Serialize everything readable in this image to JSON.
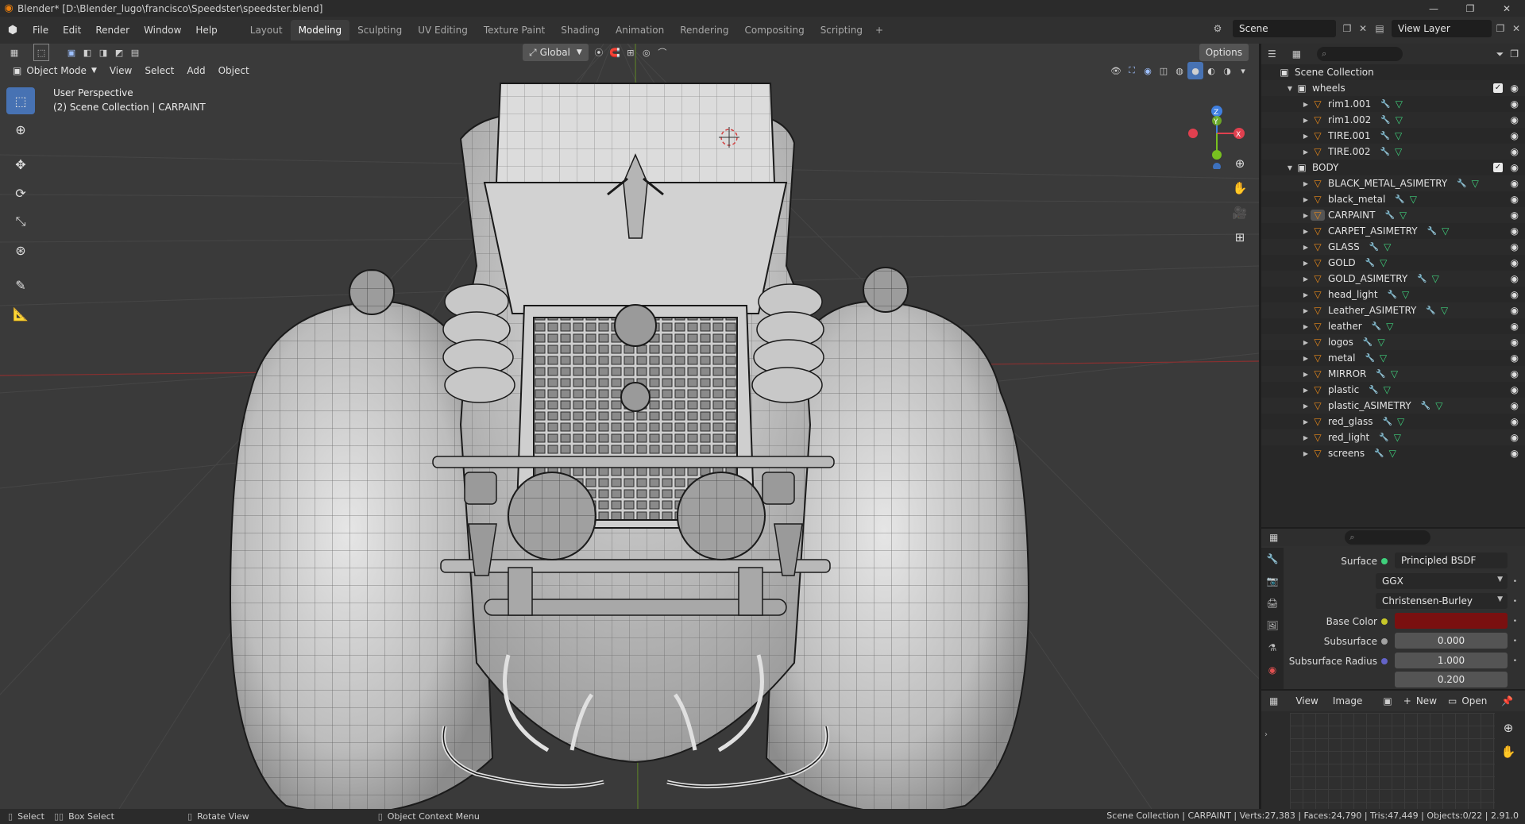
{
  "window": {
    "title": "Blender* [D:\\Blender_lugo\\francisco\\Speedster\\speedster.blend]",
    "controls": [
      "—",
      "❐",
      "✕"
    ]
  },
  "menu": {
    "items": [
      "File",
      "Edit",
      "Render",
      "Window",
      "Help"
    ],
    "workspaces": [
      "Layout",
      "Modeling",
      "Sculpting",
      "UV Editing",
      "Texture Paint",
      "Shading",
      "Animation",
      "Rendering",
      "Compositing",
      "Scripting"
    ],
    "active_workspace": "Modeling",
    "scene": "Scene",
    "view_layer": "View Layer"
  },
  "viewport": {
    "header": {
      "mode": "Object Mode",
      "menus": [
        "View",
        "Select",
        "Add",
        "Object"
      ],
      "orientation": "Global",
      "options": "Options"
    },
    "overlay": {
      "line1": "User Perspective",
      "line2": "(2) Scene Collection | CARPAINT"
    },
    "gizmo_axes": [
      "Z",
      "Y",
      "X"
    ],
    "tools": [
      "select-box-tool",
      "cursor-tool",
      "move-tool",
      "rotate-tool",
      "scale-tool",
      "transform-tool",
      "annotate-tool",
      "measure-tool"
    ]
  },
  "outliner": {
    "root": "Scene Collection",
    "collections": [
      {
        "name": "wheels",
        "items": [
          "rim1.001",
          "rim1.002",
          "TIRE.001",
          "TIRE.002"
        ]
      },
      {
        "name": "BODY",
        "items": [
          "BLACK_METAL_ASIMETRY",
          "black_metal",
          "CARPAINT",
          "CARPET_ASIMETRY",
          "GLASS",
          "GOLD",
          "GOLD_ASIMETRY",
          "head_light",
          "Leather_ASIMETRY",
          "leather",
          "logos",
          "metal",
          "MIRROR",
          "plastic",
          "plastic_ASIMETRY",
          "red_glass",
          "red_light",
          "screens"
        ]
      }
    ],
    "active_item": "CARPAINT"
  },
  "properties": {
    "surface_label": "Surface",
    "surface_value": "Principled BSDF",
    "distribution": "GGX",
    "subsurface_method": "Christensen-Burley",
    "base_color_label": "Base Color",
    "base_color": "#7a1010",
    "subsurface_label": "Subsurface",
    "subsurface_value": "0.000",
    "subsurface_radius_label": "Subsurface Radius",
    "subsurface_radius_value": "1.000",
    "subsurface_radius_value2": "0.200"
  },
  "image_editor": {
    "menus": [
      "View",
      "Image"
    ],
    "new_label": "New",
    "open_label": "Open"
  },
  "status": {
    "left": [
      {
        "key": "select",
        "label": "Select"
      },
      {
        "key": "box",
        "label": "Box Select"
      },
      {
        "key": "rotate",
        "label": "Rotate View"
      },
      {
        "key": "context",
        "label": "Object Context Menu"
      }
    ],
    "right": "Scene Collection | CARPAINT | Verts:27,383 | Faces:24,790 | Tris:47,449 | Objects:0/22 | 2.91.0"
  },
  "colors": {
    "accent": "#4772b3",
    "object_orange": "#e8891a",
    "mesh_green": "#3fd07c",
    "modifier_blue": "#6aa0e0",
    "axis_x": "#e0404f",
    "axis_y": "#78c020",
    "axis_z": "#3f7fe0"
  }
}
